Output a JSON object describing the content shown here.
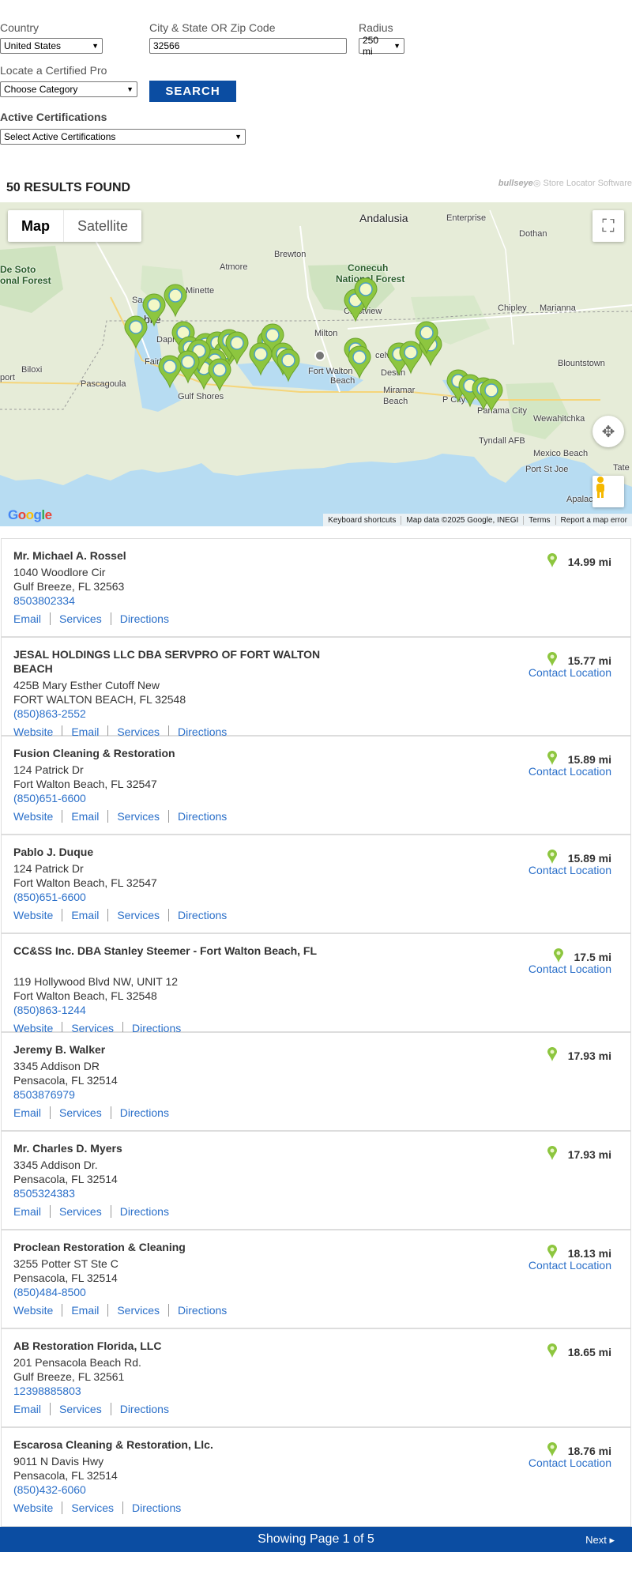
{
  "form": {
    "country_label": "Country",
    "country_value": "United States",
    "city_label": "City & State OR Zip Code",
    "city_value": "32566",
    "radius_label": "Radius",
    "radius_value": "250 mi",
    "category_label": "Locate a Certified Pro",
    "category_value": "Choose Category",
    "search_label": "SEARCH",
    "cert_label": "Active Certifications",
    "cert_value": "Select Active Certifications"
  },
  "results_header": "50 RESULTS FOUND",
  "bullseye": {
    "brand": "bullseye",
    "text": "Store Locator Software"
  },
  "map": {
    "tab_map": "Map",
    "tab_satellite": "Satellite",
    "logo": "Google",
    "footer": [
      "Keyboard shortcuts",
      "Map data ©2025 Google, INEGI",
      "Terms",
      "Report a map error"
    ],
    "labels": {
      "andalusia": "Andalusia",
      "enterprise": "Enterprise",
      "dothan": "Dothan",
      "atmore": "Atmore",
      "brewton": "Brewton",
      "conecuh": "Conecuh",
      "national_forest": "National Forest",
      "desoto": "De Soto",
      "desoto_forest": "onal Forest",
      "minette": "Minette",
      "crestview": "Crestview",
      "chipley": "Chipley",
      "marianna": "Marianna",
      "milton": "Milton",
      "fort_walton": "Fort Walton",
      "beach": "Beach",
      "destin": "Destin",
      "biloxi": "Biloxi",
      "pascagoula": "Pascagoula",
      "gulf_shores": "Gulf Shores",
      "miramar": "Miramar",
      "miramar2": "Beach",
      "panama": "Panama City",
      "blountstown": "Blountstown",
      "wewahitchka": "Wewahitchka",
      "tyndall": "Tyndall AFB",
      "mexico_beach": "Mexico Beach",
      "port_st_joe": "Port St Joe",
      "apalac": "Apalac",
      "tate": "Tate",
      "mobile": "bile",
      "fairhope": "Fairhop",
      "daphne": "Daph",
      "port": "port",
      "celville": "celville",
      "sa": "Sa",
      "pcity": "P   City"
    },
    "pin_color": "#8dc63f",
    "water_color": "#b7dcf2",
    "land_color": "#e8ecdc"
  },
  "results": [
    {
      "name": "Mr. Michael A. Rossel",
      "address": "1040 Woodlore Cir",
      "city": "Gulf Breeze, FL 32563",
      "phone": "8503802334",
      "links": [
        "Email",
        "Services",
        "Directions"
      ],
      "distance": "14.99 mi",
      "contact": ""
    },
    {
      "name": "JESAL HOLDINGS LLC DBA SERVPRO OF FORT WALTON BEACH",
      "address": "425B Mary Esther Cutoff New",
      "city": "FORT WALTON BEACH, FL 32548",
      "phone": "(850)863-2552",
      "links": [
        "Website",
        "Email",
        "Services",
        "Directions"
      ],
      "distance": "15.77 mi",
      "contact": "Contact Location"
    },
    {
      "name": "Fusion Cleaning & Restoration",
      "address": "124 Patrick Dr",
      "city": "Fort Walton Beach, FL 32547",
      "phone": "(850)651-6600",
      "links": [
        "Website",
        "Email",
        "Services",
        "Directions"
      ],
      "distance": "15.89 mi",
      "contact": "Contact Location"
    },
    {
      "name": "Pablo J. Duque",
      "address": "124 Patrick Dr",
      "city": "Fort Walton Beach, FL 32547",
      "phone": "(850)651-6600",
      "links": [
        "Website",
        "Email",
        "Services",
        "Directions"
      ],
      "distance": "15.89 mi",
      "contact": "Contact Location"
    },
    {
      "name": "CC&SS Inc. DBA Stanley Steemer - Fort Walton Beach, FL",
      "address": "119 Hollywood Blvd NW, UNIT 12",
      "city": "Fort Walton Beach, FL 32548",
      "phone": "(850)863-1244",
      "links": [
        "Website",
        "Services",
        "Directions"
      ],
      "distance": "17.5 mi",
      "contact": "Contact Location"
    },
    {
      "name": "Jeremy B. Walker",
      "address": "3345 Addison DR",
      "city": "Pensacola, FL 32514",
      "phone": "8503876979",
      "links": [
        "Email",
        "Services",
        "Directions"
      ],
      "distance": "17.93 mi",
      "contact": ""
    },
    {
      "name": "Mr. Charles D. Myers",
      "address": "3345 Addison Dr.",
      "city": "Pensacola, FL 32514",
      "phone": "8505324383",
      "links": [
        "Email",
        "Services",
        "Directions"
      ],
      "distance": "17.93 mi",
      "contact": ""
    },
    {
      "name": "Proclean Restoration & Cleaning",
      "address": "3255 Potter ST Ste C",
      "city": "Pensacola, FL 32514",
      "phone": "(850)484-8500",
      "links": [
        "Website",
        "Email",
        "Services",
        "Directions"
      ],
      "distance": "18.13 mi",
      "contact": "Contact Location"
    },
    {
      "name": "AB Restoration Florida, LLC",
      "address": "201 Pensacola Beach Rd.",
      "city": "Gulf Breeze, FL 32561",
      "phone": "12398885803",
      "links": [
        "Email",
        "Services",
        "Directions"
      ],
      "distance": "18.65 mi",
      "contact": ""
    },
    {
      "name": "Escarosa Cleaning & Restoration, Llc.",
      "address": "9011 N Davis Hwy",
      "city": "Pensacola, FL 32514",
      "phone": "(850)432-6060",
      "links": [
        "Website",
        "Services",
        "Directions"
      ],
      "distance": "18.76 mi",
      "contact": "Contact Location"
    }
  ],
  "pager": {
    "text": "Showing Page 1 of 5",
    "next": "Next ▸"
  }
}
